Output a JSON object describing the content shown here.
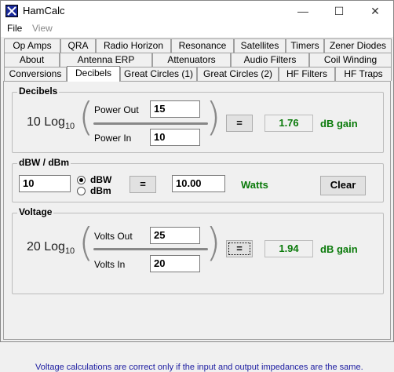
{
  "window": {
    "title": "HamCalc",
    "minimize": "—",
    "maximize": "☐",
    "close": "✕"
  },
  "menu": {
    "file": "File",
    "view": "View"
  },
  "tabs": {
    "row1": [
      "Op Amps",
      "QRA",
      "Radio Horizon",
      "Resonance",
      "Satellites",
      "Timers",
      "Zener Diodes"
    ],
    "row2": [
      "About",
      "Antenna ERP",
      "Attenuators",
      "Audio Filters",
      "Coil Winding"
    ],
    "row3": [
      "Conversions",
      "Decibels",
      "Great Circles (1)",
      "Great Circles (2)",
      "HF Filters",
      "HF Traps"
    ],
    "active": "Decibels"
  },
  "decibels": {
    "title": "Decibels",
    "formula_prefix": "10 Log",
    "formula_sub": "10",
    "power_out_label": "Power Out",
    "power_out_value": "15",
    "power_in_label": "Power In",
    "power_in_value": "10",
    "equals": "=",
    "result": "1.76",
    "unit": "dB gain"
  },
  "dbw": {
    "title": "dBW / dBm",
    "input_value": "10",
    "option_dbw": "dBW",
    "option_dbm": "dBm",
    "selected": "dBW",
    "equals": "=",
    "watts_value": "10.00",
    "watts_label": "Watts",
    "clear": "Clear"
  },
  "voltage": {
    "title": "Voltage",
    "formula_prefix": "20 Log",
    "formula_sub": "10",
    "volts_out_label": "Volts Out",
    "volts_out_value": "25",
    "volts_in_label": "Volts In",
    "volts_in_value": "20",
    "equals": "=",
    "result": "1.94",
    "unit": "dB gain"
  },
  "note": "Voltage calculations are correct only if the input and output impedances are the same.",
  "colors": {
    "result_green": "#0a7a0a",
    "note_blue": "#1a1aa0"
  }
}
